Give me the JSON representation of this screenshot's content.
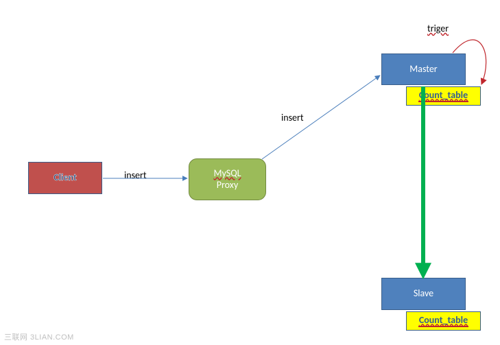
{
  "nodes": {
    "client": {
      "label": "Client"
    },
    "proxy": {
      "line1": "MySQL",
      "line2": "Proxy"
    },
    "master": {
      "label": "Master"
    },
    "slave": {
      "label": "Slave"
    },
    "count_table_top": {
      "label": "Count_table"
    },
    "count_table_bottom": {
      "label": "Count_table"
    }
  },
  "edges": {
    "client_to_proxy": {
      "label": "insert"
    },
    "proxy_to_master": {
      "label": "insert"
    },
    "trigger": {
      "label": "triger"
    }
  },
  "watermark": "三联网 3LIAN.COM",
  "colors": {
    "client_fill": "#C0504D",
    "proxy_fill": "#9BBB59",
    "blue_fill": "#4F81BD",
    "blue_border": "#385D8A",
    "yellow": "#FFFF00",
    "green_arrow": "#00B050",
    "red": "#C0272D"
  }
}
